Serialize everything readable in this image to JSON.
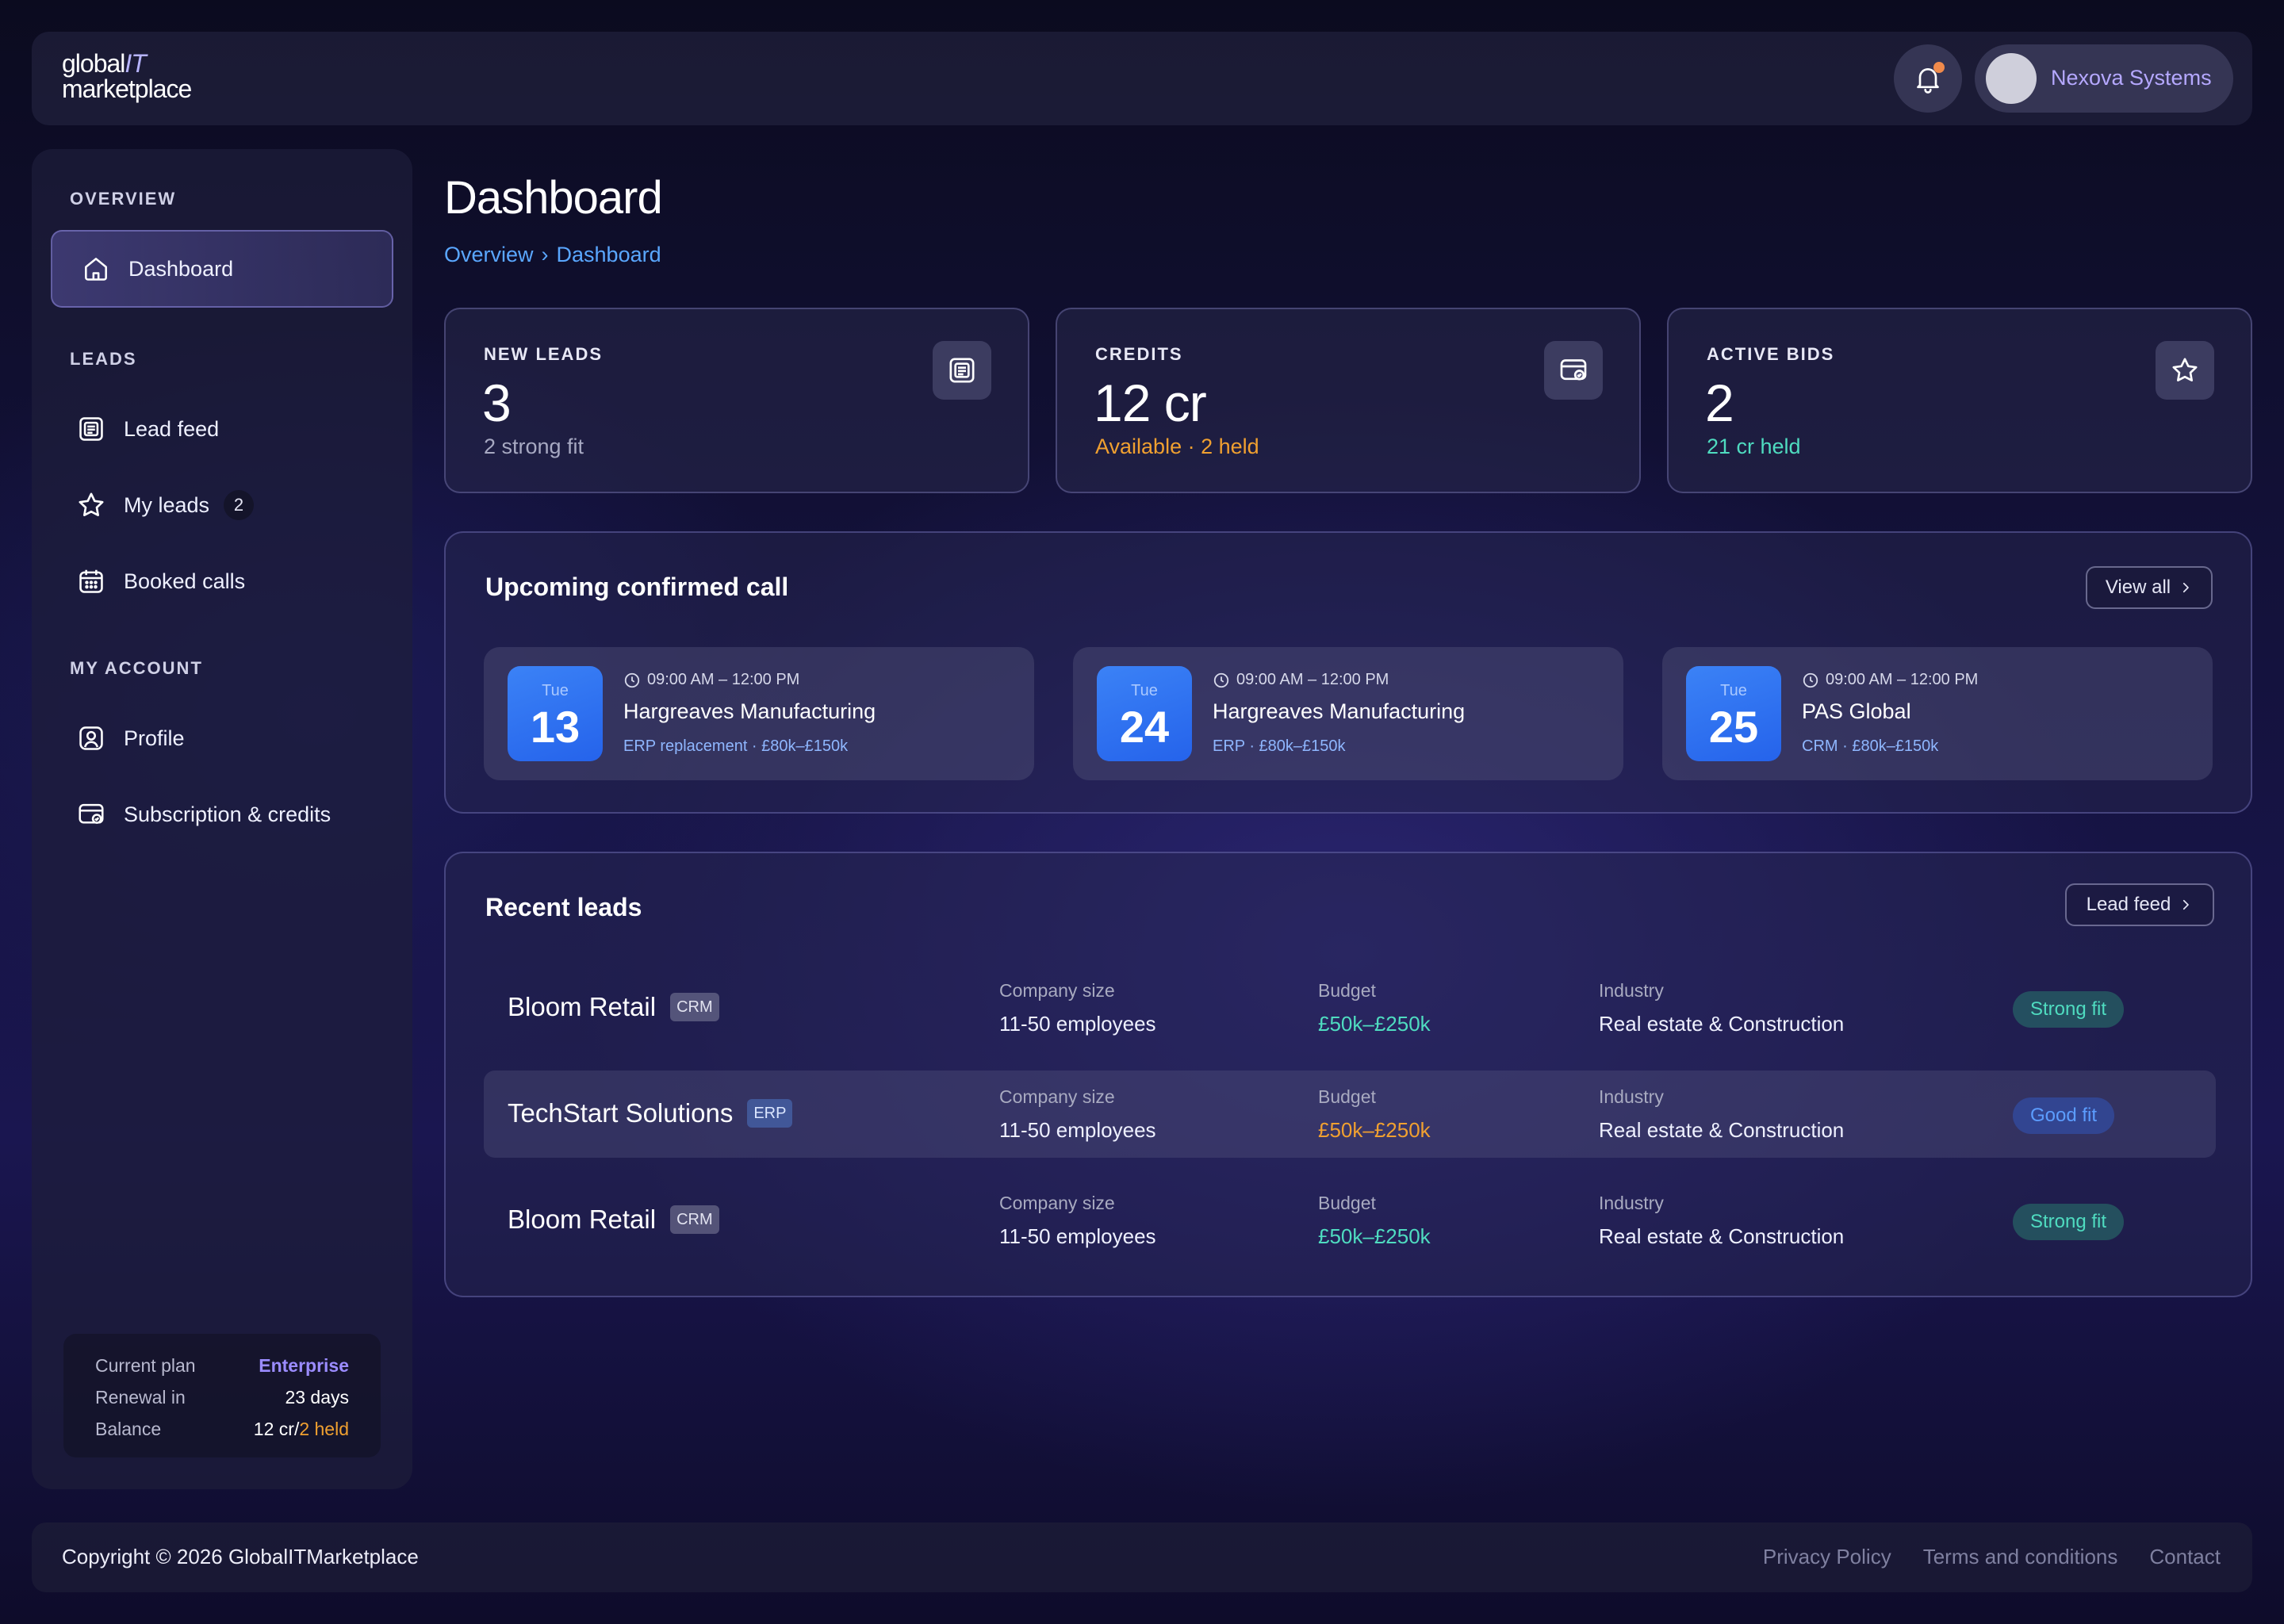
{
  "header": {
    "logo_line1": "global",
    "logo_it": "IT",
    "logo_line2": "marketplace",
    "user_name": "Nexova Systems"
  },
  "sidebar": {
    "overview_heading": "OVERVIEW",
    "dashboard_label": "Dashboard",
    "leads_heading": "LEADS",
    "lead_feed_label": "Lead feed",
    "my_leads_label": "My leads",
    "my_leads_count": "2",
    "booked_calls_label": "Booked calls",
    "account_heading": "MY ACCOUNT",
    "profile_label": "Profile",
    "subscription_label": "Subscription & credits",
    "plan": {
      "plan_key": "Current plan",
      "plan_value": "Enterprise",
      "renewal_key": "Renewal in",
      "renewal_value": "23 days",
      "balance_key": "Balance",
      "balance_value": "12 cr",
      "balance_sep": "/",
      "balance_held": "2 held"
    }
  },
  "main": {
    "title": "Dashboard",
    "breadcrumb": [
      "Overview",
      "›",
      "Dashboard"
    ],
    "stats": [
      {
        "label": "NEW LEADS",
        "value": "3",
        "sub": "2 strong fit",
        "icon": "lead-feed-icon"
      },
      {
        "label": "CREDITS",
        "value": "12 cr",
        "sub": "Available · 2 held",
        "icon": "credits-icon"
      },
      {
        "label": "ACTIVE BIDS",
        "value": "2",
        "sub": "21 cr held",
        "icon": "star-icon"
      }
    ],
    "calls": {
      "title": "Upcoming confirmed call",
      "view_all": "View all",
      "items": [
        {
          "dow": "Tue",
          "day": "13",
          "time": "09:00 AM – 12:00 PM",
          "company": "Hargreaves Manufacturing",
          "meta": "ERP replacement · £80k–£150k"
        },
        {
          "dow": "Tue",
          "day": "24",
          "time": "09:00 AM – 12:00 PM",
          "company": "Hargreaves Manufacturing",
          "meta": "ERP · £80k–£150k"
        },
        {
          "dow": "Tue",
          "day": "25",
          "time": "09:00 AM – 12:00 PM",
          "company": "PAS Global",
          "meta": "CRM · £80k–£150k"
        }
      ]
    },
    "recent": {
      "title": "Recent leads",
      "lead_feed": "Lead feed",
      "col_size": "Company size",
      "col_budget": "Budget",
      "col_industry": "Industry",
      "rows": [
        {
          "name": "Bloom Retail",
          "tag": "CRM",
          "size": "11-50 employees",
          "budget": "£50k–£250k",
          "industry": "Real estate & Construction",
          "fit": "Strong fit"
        },
        {
          "name": "TechStart Solutions",
          "tag": "ERP",
          "size": "11-50 employees",
          "budget": "£50k–£250k",
          "industry": "Real estate & Construction",
          "fit": "Good fit"
        },
        {
          "name": "Bloom Retail",
          "tag": "CRM",
          "size": "11-50 employees",
          "budget": "£50k–£250k",
          "industry": "Real estate & Construction",
          "fit": "Strong fit"
        }
      ]
    }
  },
  "footer": {
    "copyright": "Copyright © 2026 GlobalITMarketplace",
    "links": [
      "Privacy Policy",
      "Terms and conditions",
      "Contact"
    ]
  },
  "colors": {
    "accent_blue": "#3b82f6",
    "budget_green": "#4fdcc0",
    "budget_orange": "#f0a030",
    "credits_orange": "#f0a030",
    "bids_teal": "#4fdcc0",
    "enterprise_purple": "#9b8cff"
  }
}
